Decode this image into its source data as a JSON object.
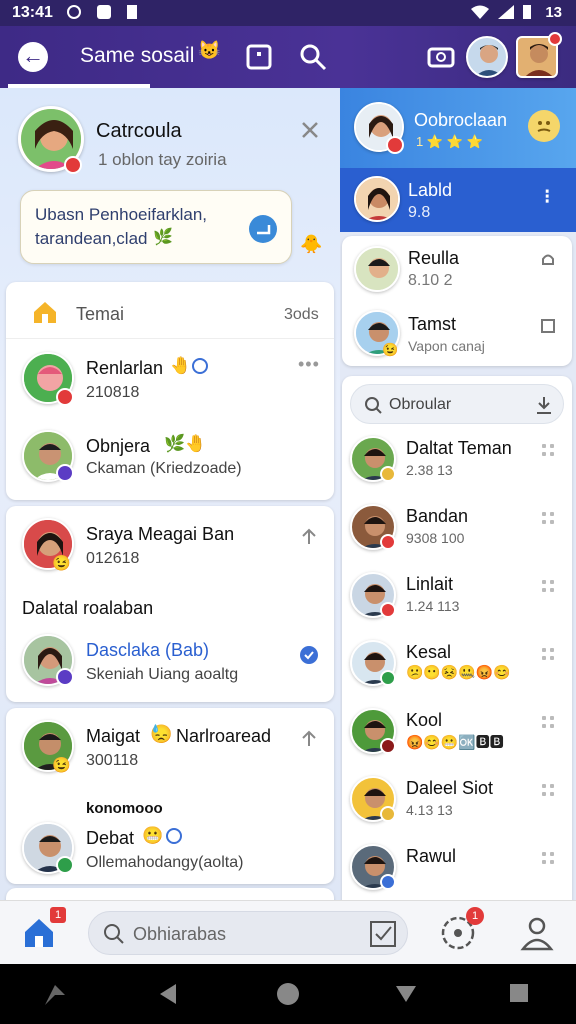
{
  "status_bar": {
    "time": "13:41",
    "right_text": "13"
  },
  "app_bar": {
    "title": "Same sosail"
  },
  "profile": {
    "name": "Catrcoula",
    "subtitle": "1 oblon tay zoiria"
  },
  "bubble": {
    "line1": "Ubasn Penhoeifarklan,",
    "line2": "tarandean,clad"
  },
  "left_cards": {
    "header": {
      "title": "Temai",
      "count": "3ods"
    },
    "items": [
      {
        "name": "Renlarlan",
        "sub": "210818"
      },
      {
        "name": "Obnjera",
        "sub": "Ckaman (Kriedzoade)"
      },
      {
        "name": "Sraya Meagai Ban",
        "sub": "012618"
      },
      {
        "section": "Dalatal roalaban"
      },
      {
        "name": "Dasclaka (Bab)",
        "sub": "Skeniah Uiang aoaltg"
      },
      {
        "name": "Maigat",
        "name2": "Narlroaread",
        "sub": "300118"
      },
      {
        "section": "konomooo"
      },
      {
        "name": "Debat",
        "sub": "Ollemahodangy(aolta)"
      }
    ]
  },
  "right_panel": {
    "top": [
      {
        "name": "Oobroclaan",
        "sub": "1 ⭐ ⭐ ⭐"
      },
      {
        "name": "Labld",
        "sub": "9.8"
      }
    ],
    "pinned": [
      {
        "name": "Reulla",
        "sub": "8.10 2"
      },
      {
        "name": "Tamst",
        "sub": "Vapon canaj"
      }
    ],
    "search_placeholder": "Obroular",
    "list": [
      {
        "name": "Daltat Teman",
        "sub": "2.38 13"
      },
      {
        "name": "Bandan",
        "sub": "9308 100"
      },
      {
        "name": "Linlait",
        "sub": "1.24 113"
      },
      {
        "name": "Kesal",
        "sub": ""
      },
      {
        "name": "Kool",
        "sub": ""
      },
      {
        "name": "Daleel Siot",
        "sub": "4.13 13"
      },
      {
        "name": "Rawul",
        "sub": ""
      }
    ]
  },
  "bottom_nav": {
    "search_placeholder": "Obhiarabas",
    "home_badge": "1",
    "notif_badge": "1"
  },
  "colors": {
    "primary": "#3e2a86",
    "accent_blue": "#3b6fd6",
    "right_active": "#2a5fd0"
  }
}
